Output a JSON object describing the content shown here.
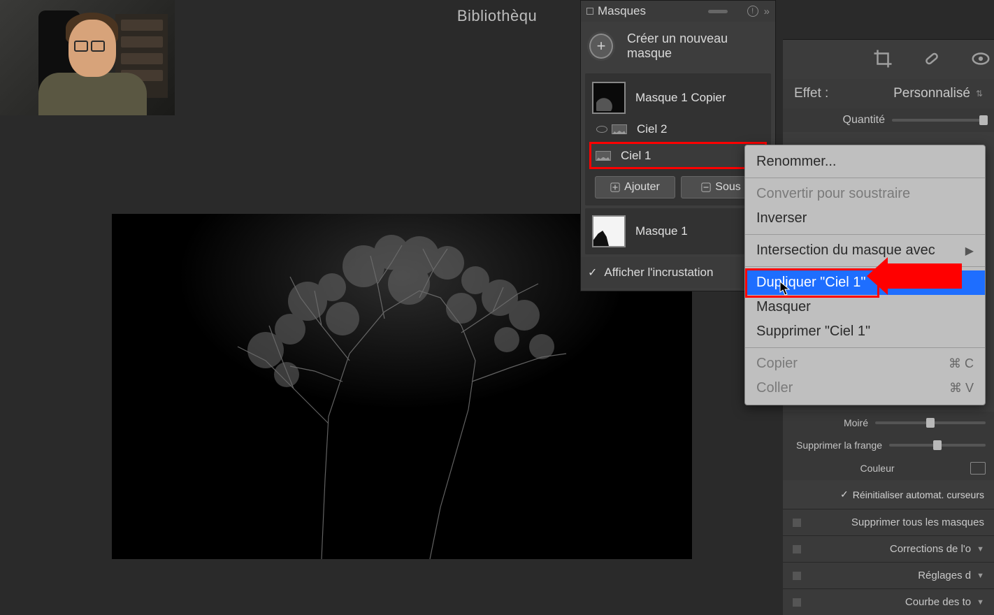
{
  "top_bar": {
    "breadcrumb": "Bibliothèqu"
  },
  "masks_panel": {
    "title": "Masques",
    "new_mask": "Créer un nouveau masque",
    "groups": [
      {
        "name": "Masque 1 Copier",
        "subs": [
          {
            "name": "Ciel 2"
          },
          {
            "name": "Ciel 1",
            "selected": true
          }
        ],
        "add_btn": "Ajouter",
        "sub_btn": "Sous"
      },
      {
        "name": "Masque 1"
      }
    ],
    "overlay_check": "Afficher l'incrustation"
  },
  "context_menu": {
    "rename": "Renommer...",
    "convert": "Convertir pour soustraire",
    "invert": "Inverser",
    "intersect": "Intersection du masque avec",
    "duplicate": "Dupliquer \"Ciel 1\"",
    "hide": "Masquer",
    "delete": "Supprimer \"Ciel 1\"",
    "copy": "Copier",
    "copy_sc": "⌘ C",
    "paste": "Coller",
    "paste_sc": "⌘ V"
  },
  "right_panel": {
    "effect_label": "Effet :",
    "effect_value": "Personnalisé",
    "quantity": "Quantité",
    "sliders": [
      {
        "label": "Moiré",
        "pos": 50
      },
      {
        "label": "Supprimer la frange",
        "pos": 50
      }
    ],
    "color_label": "Couleur",
    "reset": "Réinitialiser automat. curseurs",
    "footer": [
      "Supprimer tous les masques",
      "Corrections de l'o",
      "Réglages d",
      "Courbe des to"
    ]
  }
}
